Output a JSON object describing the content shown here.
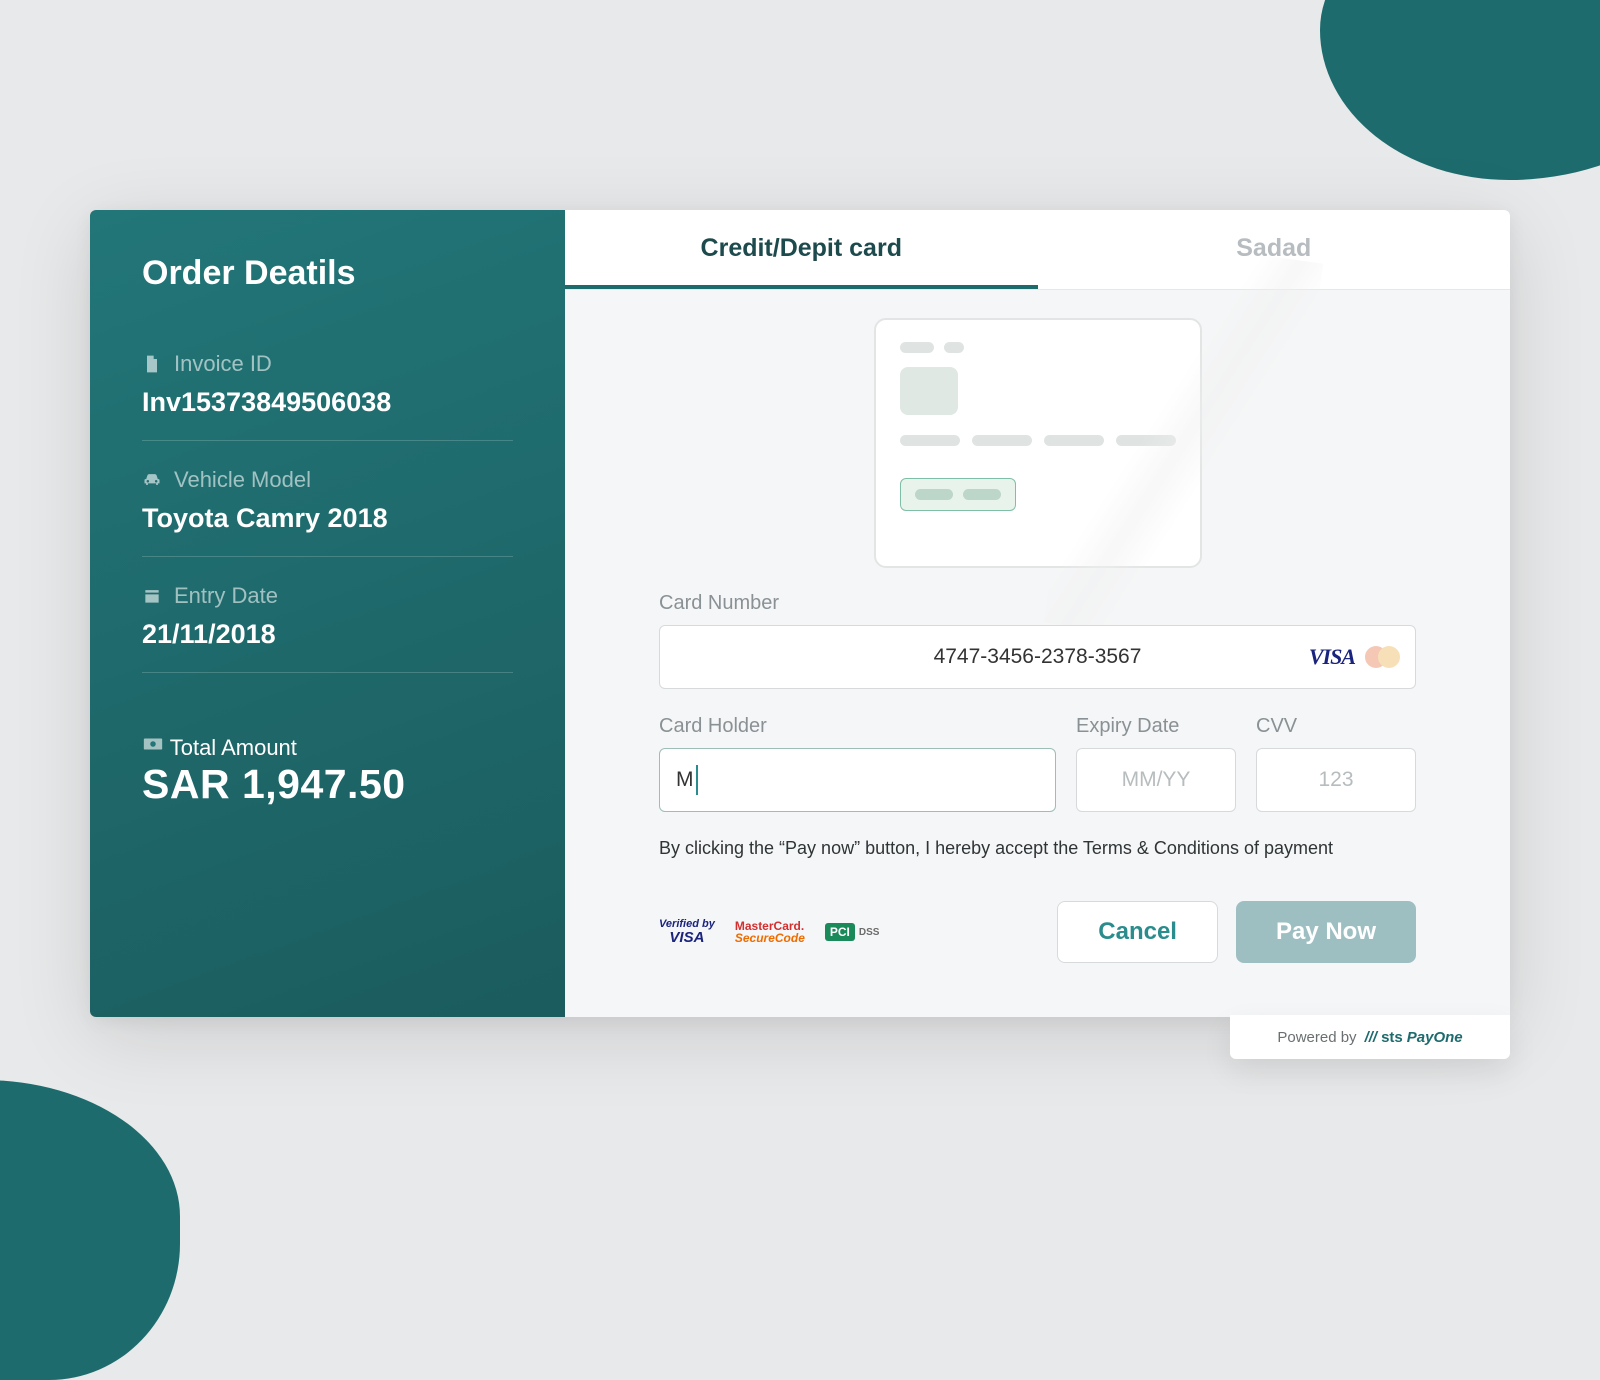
{
  "decor": {},
  "order": {
    "title": "Order Deatils",
    "invoice_label": "Invoice ID",
    "invoice_value": "Inv15373849506038",
    "model_label": "Vehicle Model",
    "model_value": "Toyota Camry 2018",
    "date_label": "Entry Date",
    "date_value": "21/11/2018",
    "total_label": "Total Amount",
    "total_value": "SAR 1,947.50"
  },
  "tabs": {
    "card": "Credit/Depit card",
    "sadad": "Sadad"
  },
  "form": {
    "card_number_label": "Card Number",
    "card_number_value": "4747-3456-2378-3567",
    "holder_label": "Card Holder",
    "holder_value": "M",
    "expiry_label": "Expiry Date",
    "expiry_placeholder": "MM/YY",
    "cvv_label": "CVV",
    "cvv_placeholder": "123",
    "disclaimer": "By clicking the “Pay now” button, I hereby accept the Terms & Conditions of payment"
  },
  "brands": {
    "visa": "VISA",
    "vbv_top": "Verified by",
    "vbv_bottom": "VISA",
    "msc_top": "MasterCard.",
    "msc_bottom": "SecureCode",
    "pci_box": "PCI",
    "pci_dss": "DSS"
  },
  "buttons": {
    "cancel": "Cancel",
    "pay": "Pay Now"
  },
  "powered": {
    "prefix": "Powered by",
    "brand1": "sts",
    "brand2": "PayOne"
  }
}
